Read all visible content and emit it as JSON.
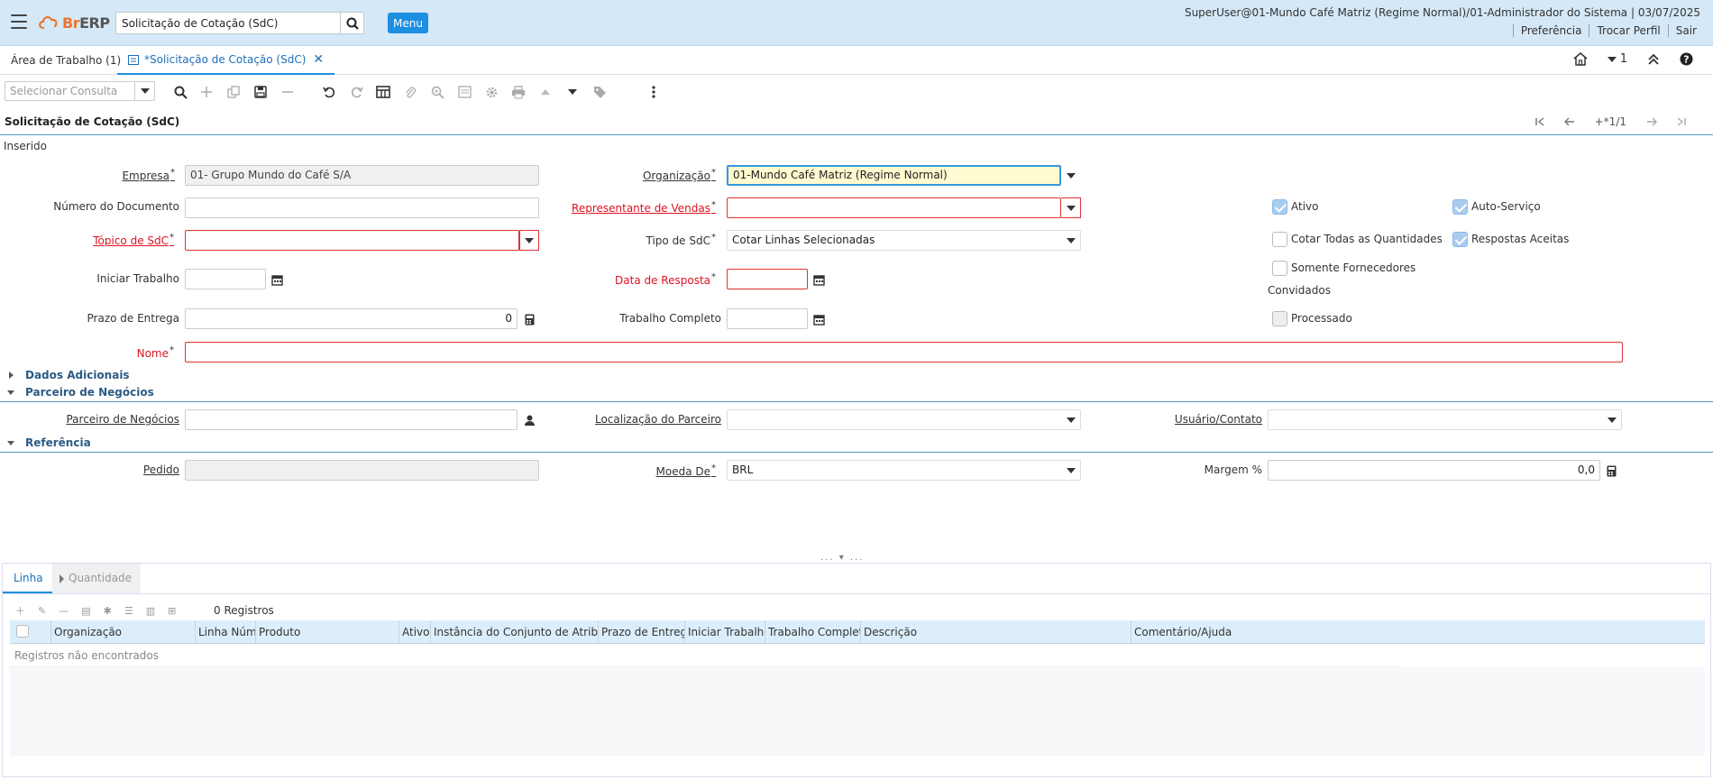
{
  "header": {
    "logo_text": "BrERP",
    "search_value": "Solicitação de Cotação (SdC)",
    "menu_label": "Menu",
    "user_info": "SuperUser@01-Mundo Café Matriz (Regime Normal)/01-Administrador do Sistema | 03/07/2025",
    "links": [
      "Preferência",
      "Trocar Perfil",
      "Sair"
    ]
  },
  "tabs": {
    "workspace": "Área de Trabalho (1)",
    "current": "*Solicitação de Cotação (SdC)",
    "window_count": "1"
  },
  "toolbar": {
    "query_placeholder": "Selecionar Consulta"
  },
  "window": {
    "title": "Solicitação de Cotação (SdC)",
    "record_nav": "+*1/1",
    "status": "Inserido"
  },
  "form": {
    "empresa": {
      "label": "Empresa",
      "value": "01- Grupo Mundo do Café S/A"
    },
    "organizacao": {
      "label": "Organização",
      "value": "01-Mundo Café Matriz (Regime Normal)"
    },
    "numero_documento": {
      "label": "Número do Documento",
      "value": ""
    },
    "representante": {
      "label": "Representante de Vendas",
      "value": ""
    },
    "topico": {
      "label": "Tópico de SdC",
      "value": ""
    },
    "tipo": {
      "label": "Tipo de SdC",
      "value": "Cotar Linhas Selecionadas"
    },
    "iniciar_trabalho": {
      "label": "Iniciar Trabalho",
      "value": ""
    },
    "data_resposta": {
      "label": "Data de Resposta",
      "value": ""
    },
    "prazo_entrega": {
      "label": "Prazo de Entrega",
      "value": "0"
    },
    "trabalho_completo": {
      "label": "Trabalho Completo",
      "value": ""
    },
    "nome": {
      "label": "Nome",
      "value": ""
    },
    "checkboxes": {
      "ativo": {
        "label": "Ativo",
        "checked": true
      },
      "auto_servico": {
        "label": "Auto-Serviço",
        "checked": true
      },
      "cotar_todas": {
        "label": "Cotar Todas as Quantidades",
        "checked": false
      },
      "respostas_aceitas": {
        "label": "Respostas Aceitas",
        "checked": true
      },
      "somente_fornecedores": {
        "label": "Somente Fornecedores",
        "checked": false
      },
      "somente_fornecedores_line2": "Convidados",
      "processado": {
        "label": "Processado",
        "checked": false
      }
    }
  },
  "sections": {
    "dados_adicionais": "Dados Adicionais",
    "parceiro": "Parceiro de Negócios",
    "referencia": "Referência"
  },
  "parceiro": {
    "parceiro": {
      "label": "Parceiro de Negócios",
      "value": ""
    },
    "localizacao": {
      "label": "Localização do Parceiro",
      "value": ""
    },
    "usuario": {
      "label": "Usuário/Contato",
      "value": ""
    }
  },
  "referencia": {
    "pedido": {
      "label": "Pedido",
      "value": ""
    },
    "moeda": {
      "label": "Moeda De",
      "value": "BRL"
    },
    "margem": {
      "label": "Margem %",
      "value": "0,0"
    }
  },
  "detail": {
    "tabs": [
      "Linha",
      "Quantidade"
    ],
    "record_count": "0 Registros",
    "columns": [
      "Organização",
      "Linha Núm.",
      "Produto",
      "Ativo",
      "Instância do Conjunto de Atributos",
      "Prazo de Entrega",
      "Iniciar Trabalho",
      "Trabalho Completo",
      "Descrição",
      "Comentário/Ajuda"
    ],
    "empty_message": "Registros não encontrados"
  }
}
